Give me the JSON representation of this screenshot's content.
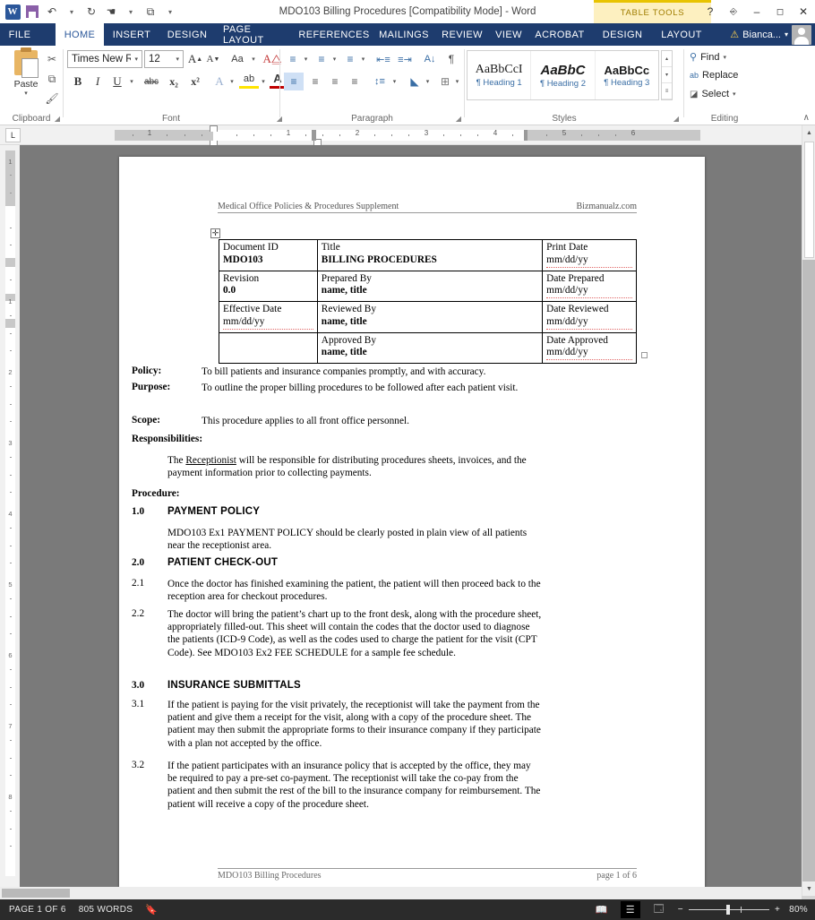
{
  "window": {
    "title": "MDO103 Billing Procedures [Compatibility Mode] - Word",
    "contextual_tab_group": "TABLE TOOLS",
    "quick_access": [
      {
        "name": "word-logo",
        "glyph": "W"
      },
      {
        "name": "save-icon",
        "glyph": ""
      },
      {
        "name": "undo-icon",
        "glyph": "↶"
      },
      {
        "name": "redo-icon",
        "glyph": "↻"
      },
      {
        "name": "touch-mode-icon",
        "glyph": "☚"
      },
      {
        "name": "customize-qat-icon",
        "glyph": "▾"
      }
    ],
    "controls": {
      "help": "?",
      "ribbon_display": "⬆",
      "minimize": "–",
      "maximize": "⬜",
      "close": "✕"
    }
  },
  "tabs": [
    {
      "label": "FILE",
      "active": false,
      "kind": "file"
    },
    {
      "label": "HOME",
      "active": true,
      "kind": "normal"
    },
    {
      "label": "INSERT",
      "active": false,
      "kind": "normal"
    },
    {
      "label": "DESIGN",
      "active": false,
      "kind": "normal"
    },
    {
      "label": "PAGE LAYOUT",
      "active": false,
      "kind": "normal"
    },
    {
      "label": "REFERENCES",
      "active": false,
      "kind": "normal"
    },
    {
      "label": "MAILINGS",
      "active": false,
      "kind": "normal"
    },
    {
      "label": "REVIEW",
      "active": false,
      "kind": "normal"
    },
    {
      "label": "VIEW",
      "active": false,
      "kind": "normal"
    },
    {
      "label": "ACROBAT",
      "active": false,
      "kind": "normal"
    },
    {
      "label": "DESIGN",
      "active": false,
      "kind": "ctx"
    },
    {
      "label": "LAYOUT",
      "active": false,
      "kind": "ctx"
    }
  ],
  "account": {
    "name": "Bianca...",
    "warning_icon": "⚠",
    "dropdown": "▾"
  },
  "ribbon": {
    "groups": [
      {
        "name": "Clipboard"
      },
      {
        "name": "Font"
      },
      {
        "name": "Paragraph"
      },
      {
        "name": "Styles"
      },
      {
        "name": "Editing"
      }
    ],
    "clipboard": {
      "paste_label": "Paste",
      "paste_arrow": "▾",
      "cut_icon": "✂",
      "copy_icon": "⧉",
      "format_painter_icon": "🖌"
    },
    "font": {
      "font_name": "Times New Rc",
      "font_size": "12",
      "grow_font": "A",
      "shrink_font": "A",
      "change_case": "Aa",
      "clear_formatting": "A",
      "bold": "B",
      "italic": "I",
      "underline": "U",
      "strikethrough": "abc",
      "subscript": "x₂",
      "superscript": "x²",
      "text_effects": "A",
      "highlight": "ab",
      "font_color": "A",
      "dropdown": "▾"
    },
    "paragraph": {
      "bullets": "≡",
      "numbering": "≡",
      "multilevel": "≡",
      "decrease_indent": "←≡",
      "increase_indent": "≡→",
      "sort": "A↓",
      "show_marks": "¶",
      "align_left": "≡",
      "align_center": "≡",
      "align_right": "≡",
      "justify": "≡",
      "line_spacing": "↕≡",
      "shading": "△",
      "borders": "⊞"
    },
    "styles": {
      "items": [
        {
          "preview": "AaBbCcI",
          "name": "¶ Heading 1"
        },
        {
          "preview": "AaBbC",
          "name": "¶ Heading 2"
        },
        {
          "preview": "AaBbCc",
          "name": "¶ Heading 3"
        }
      ],
      "scroll_up": "▴",
      "scroll_down": "▾",
      "more": "≡"
    },
    "editing": {
      "find": "Find",
      "find_icon": "🔍",
      "find_arrow": "▾",
      "replace": "Replace",
      "replace_icon": "ab",
      "select": "Select",
      "select_icon": "↖",
      "select_arrow": "▾"
    },
    "collapse_ribbon": "∧",
    "dialog_launcher": "⬌"
  },
  "ruler": {
    "tab_selector": "L",
    "h_numbers": [
      "1",
      "1",
      "2",
      "3",
      "4",
      "5",
      "6"
    ],
    "v_numbers": [
      "1",
      "1",
      "2",
      "3",
      "4",
      "5",
      "6",
      "7",
      "8"
    ]
  },
  "document": {
    "header": {
      "left": "Medical Office Policies & Procedures Supplement",
      "right": "Bizmanualz.com"
    },
    "table_move_handle": "✥",
    "info_table": [
      [
        {
          "label": "Document ID",
          "value": "MDO103",
          "bold": true
        },
        {
          "label": "Title",
          "value": "BILLING PROCEDURES",
          "bold": true
        },
        {
          "label": "Print Date",
          "value": "mm/dd/yy",
          "bold": false,
          "spell": true
        }
      ],
      [
        {
          "label": "Revision",
          "value": "0.0",
          "bold": true
        },
        {
          "label": "Prepared By",
          "value": "name, title",
          "bold": true
        },
        {
          "label": "Date Prepared",
          "value": "mm/dd/yy",
          "bold": false,
          "spell": true
        }
      ],
      [
        {
          "label": "Effective Date",
          "value": "mm/dd/yy",
          "bold": false,
          "spell": true
        },
        {
          "label": "Reviewed By",
          "value": "name, title",
          "bold": true
        },
        {
          "label": "Date Reviewed",
          "value": "mm/dd/yy",
          "bold": false,
          "spell": true
        }
      ],
      [
        {
          "label": "",
          "value": "",
          "bold": false
        },
        {
          "label": "Approved By",
          "value": "name, title",
          "bold": true
        },
        {
          "label": "Date Approved",
          "value": "mm/dd/yy",
          "bold": false,
          "spell": true
        }
      ]
    ],
    "sections": {
      "policy_label": "Policy:",
      "policy_text": "To bill patients and insurance companies promptly, and with accuracy.",
      "purpose_label": "Purpose:",
      "purpose_text": "To outline the proper billing procedures to be followed after each patient visit.",
      "scope_label": "Scope:",
      "scope_text": "This procedure applies to all front office personnel.",
      "responsibilities_label": "Responsibilities:",
      "responsibilities_pre": "The ",
      "responsibilities_role": "Receptionist",
      "responsibilities_post": " will be responsible for distributing procedures sheets, invoices, and the payment information prior to collecting payments.",
      "procedure_label": "Procedure:"
    },
    "procedures": [
      {
        "number": "1.0",
        "heading": "PAYMENT POLICY",
        "items": [
          {
            "number": "",
            "text": "MDO103 Ex1 PAYMENT POLICY should be clearly posted in plain view of all patients near the receptionist area."
          }
        ]
      },
      {
        "number": "2.0",
        "heading": "PATIENT CHECK-OUT",
        "items": [
          {
            "number": "2.1",
            "text": "Once the doctor has finished examining the patient, the patient will then proceed back to the reception area for checkout procedures."
          },
          {
            "number": "2.2",
            "text": "The doctor will bring the patient’s chart up to the front desk, along with the procedure sheet, appropriately filled-out.  This sheet will contain the codes that the doctor used to diagnose the patients (ICD-9 Code), as well as the codes used to charge the patient for the visit (CPT Code).  See MDO103 Ex2 FEE SCHEDULE for a sample fee schedule."
          }
        ]
      },
      {
        "number": "3.0",
        "heading": "INSURANCE SUBMITTALS",
        "items": [
          {
            "number": "3.1",
            "text": "If the patient is paying for the visit privately, the receptionist will take the payment from the patient and give them a receipt for the visit, along with a copy of the procedure sheet.  The patient may then submit the appropriate forms to their insurance company if they participate with a plan not accepted by the office."
          },
          {
            "number": "3.2",
            "text": "If the patient participates with an insurance policy that is accepted by the office, they may be required to pay a pre-set co-payment.  The receptionist will take the co-pay from the patient and then submit the rest of the bill to the insurance company for reimbursement.  The patient will receive a copy of the procedure sheet."
          }
        ]
      }
    ],
    "footer": {
      "left": "MDO103 Billing Procedures",
      "right": "page 1 of 6"
    }
  },
  "status_bar": {
    "page": "PAGE 1 OF 6",
    "words": "805 WORDS",
    "proofing_icon": "📖",
    "views": [
      {
        "name": "read-mode",
        "glyph": "📖",
        "active": false
      },
      {
        "name": "print-layout",
        "glyph": "☰",
        "active": true
      },
      {
        "name": "web-layout",
        "glyph": "🗔",
        "active": false
      }
    ],
    "zoom_out": "−",
    "zoom_in": "+",
    "zoom_level": "80%"
  },
  "colors": {
    "word_blue": "#2b579a",
    "file_tab": "#1e3c6e",
    "contextual_yellow": "#e8c300",
    "status_bar": "#2b2b2b",
    "doc_background": "#7a7a7a"
  }
}
